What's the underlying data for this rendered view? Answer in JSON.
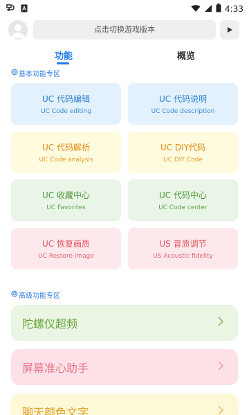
{
  "status_bar": {
    "time": "4:33"
  },
  "header": {
    "search_placeholder": "点击切换游戏版本"
  },
  "tabs": [
    {
      "label": "功能",
      "active": true
    },
    {
      "label": "概览",
      "active": false
    }
  ],
  "basic_section": {
    "title": "基本功能专区",
    "cards": [
      {
        "title": "UC 代码编辑",
        "subtitle": "UC Code editing",
        "color": "blue"
      },
      {
        "title": "UC 代码说明",
        "subtitle": "UC Code description",
        "color": "blue"
      },
      {
        "title": "UC 代码解析",
        "subtitle": "UC Code analysis",
        "color": "yellow"
      },
      {
        "title": "UC DIY代码",
        "subtitle": "UC DIY Code",
        "color": "yellow"
      },
      {
        "title": "UC 收藏中心",
        "subtitle": "UC Favorites",
        "color": "green"
      },
      {
        "title": "UC 代码中心",
        "subtitle": "UC Code center",
        "color": "green"
      },
      {
        "title": "UC 恢复画质",
        "subtitle": "UC Restore image",
        "color": "pink"
      },
      {
        "title": "US 音质调节",
        "subtitle": "US Acoustic fidelity",
        "color": "pink"
      }
    ]
  },
  "advanced_section": {
    "title": "高级功能专区",
    "items": [
      {
        "label": "陀螺仪超频",
        "color": "green"
      },
      {
        "label": "屏幕准心助手",
        "color": "pink"
      },
      {
        "label": "聊天颜色文字",
        "color": "yellow"
      }
    ]
  },
  "colors": {
    "accent": "#1f7be8",
    "blue_bg": "#e2f1fd",
    "yellow_bg": "#fefbdf",
    "green_bg": "#e9f5e6",
    "pink_bg": "#fde9ec"
  }
}
